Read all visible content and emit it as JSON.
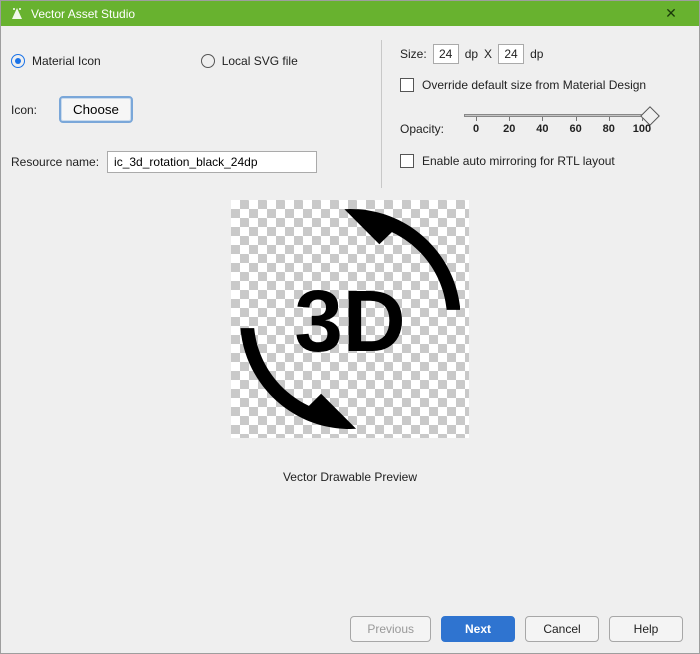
{
  "titlebar": {
    "title": "Vector Asset Studio"
  },
  "source": {
    "material_label": "Material Icon",
    "svg_label": "Local SVG file",
    "selected": "material"
  },
  "icon": {
    "label": "Icon:",
    "choose_label": "Choose"
  },
  "resource": {
    "label": "Resource name:",
    "value": "ic_3d_rotation_black_24dp"
  },
  "size": {
    "label": "Size:",
    "width": "24",
    "height": "24",
    "unit": "dp",
    "sep": "X"
  },
  "override": {
    "label": "Override default size from Material Design",
    "checked": false
  },
  "opacity": {
    "label": "Opacity:",
    "value": 100,
    "ticks": [
      "0",
      "20",
      "40",
      "60",
      "80",
      "100"
    ]
  },
  "rtl": {
    "label": "Enable auto mirroring for RTL layout",
    "checked": false
  },
  "preview": {
    "caption": "Vector Drawable Preview"
  },
  "buttons": {
    "previous": "Previous",
    "next": "Next",
    "cancel": "Cancel",
    "help": "Help"
  }
}
